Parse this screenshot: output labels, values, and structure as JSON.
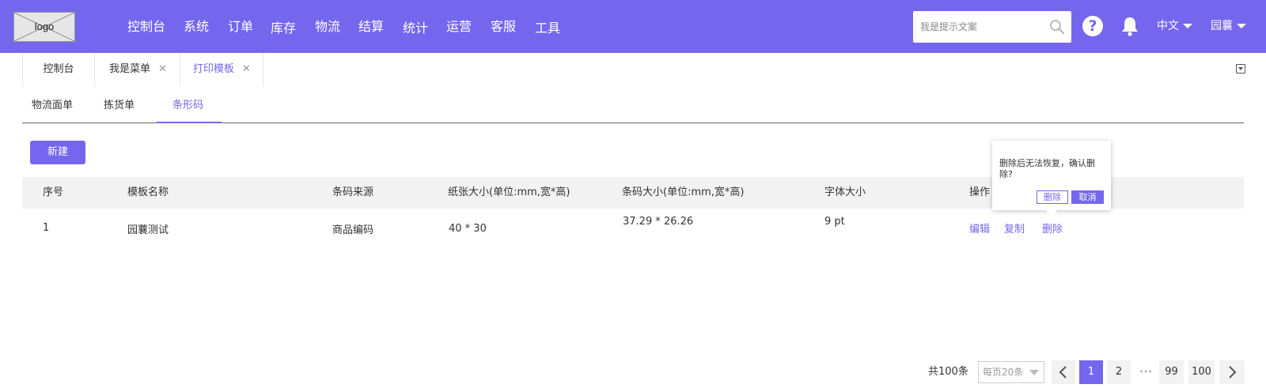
{
  "header": {
    "logo_text": "logo",
    "nav": [
      "控制台",
      "系统",
      "订单",
      "库存",
      "物流",
      "结算",
      "统计",
      "运营",
      "客服",
      "工具"
    ],
    "search_placeholder": "我是提示文案",
    "help_symbol": "?",
    "language": "中文",
    "user": "园蘘"
  },
  "page_tabs": [
    {
      "label": "控制台",
      "closable": false
    },
    {
      "label": "我是菜单",
      "closable": true
    },
    {
      "label": "打印模板",
      "closable": true,
      "active": true
    }
  ],
  "close_glyph": "✕",
  "sub_tabs": [
    {
      "label": "物流面单"
    },
    {
      "label": "拣货单"
    },
    {
      "label": "条形码",
      "active": true
    }
  ],
  "new_button": "新建",
  "table": {
    "headers": [
      "序号",
      "模板名称",
      "条码来源",
      "纸张大小(单位:mm,宽*高)",
      "条码大小(单位:mm,宽*高)",
      "字体大小",
      "操作"
    ],
    "rows": [
      {
        "index": "1",
        "name": "园蘘测试",
        "source": "商品编码",
        "paper_size": "40 * 30",
        "barcode_size": "37.29 * 26.26",
        "font_size": "9 pt",
        "actions": [
          "编辑",
          "复制",
          "删除"
        ]
      }
    ]
  },
  "popconfirm": {
    "message": "删除后无法恢复，确认删除?",
    "confirm": "删除",
    "cancel": "取消"
  },
  "pagination": {
    "total": "共100条",
    "page_size": "每页20条",
    "pages": [
      "1",
      "2",
      "99",
      "100"
    ],
    "current": "1",
    "ellipsis": "•••"
  },
  "colors": {
    "accent": "#7566ee",
    "header_bg": "#7566ee",
    "table_header_bg": "#f2f2f2"
  },
  "icons": [
    "logo-placeholder-icon",
    "search-icon",
    "help-icon",
    "bell-icon",
    "caret-down-icon",
    "close-icon",
    "collapse-icon",
    "chevron-left-icon",
    "chevron-right-icon",
    "ellipsis-icon"
  ]
}
